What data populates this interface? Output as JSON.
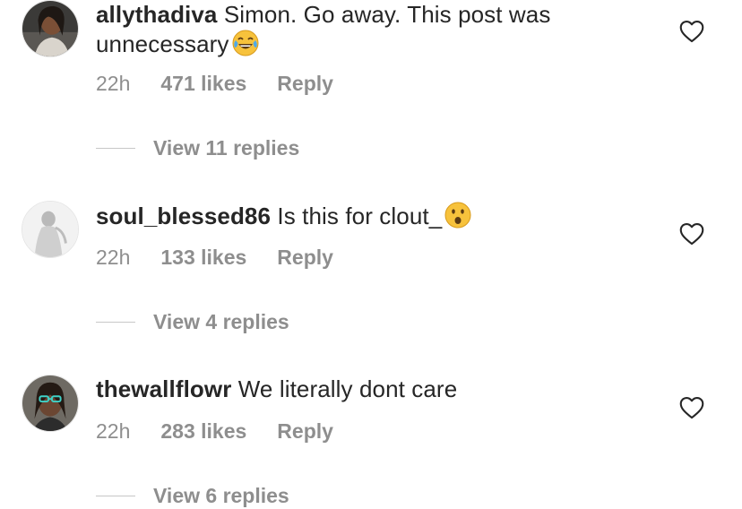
{
  "comments": [
    {
      "username": "allythadiva",
      "text": "Simon. Go away. This post was unnecessary",
      "emoji": "face-with-tears-of-joy",
      "time": "22h",
      "likes": "471 likes",
      "reply": "Reply",
      "view_replies": "View 11 replies"
    },
    {
      "username": "soul_blessed86",
      "text": "Is this for clout_",
      "emoji": "face-with-open-mouth",
      "time": "22h",
      "likes": "133 likes",
      "reply": "Reply",
      "view_replies": "View 4 replies"
    },
    {
      "username": "thewallflowr",
      "text": "We literally dont care",
      "emoji": "",
      "time": "22h",
      "likes": "283 likes",
      "reply": "Reply",
      "view_replies": "View 6 replies"
    }
  ],
  "colors": {
    "text": "#262626",
    "secondary": "#8e8e8e",
    "divider": "#c7c7c7"
  },
  "icons": {
    "like": "heart-outline-icon"
  }
}
